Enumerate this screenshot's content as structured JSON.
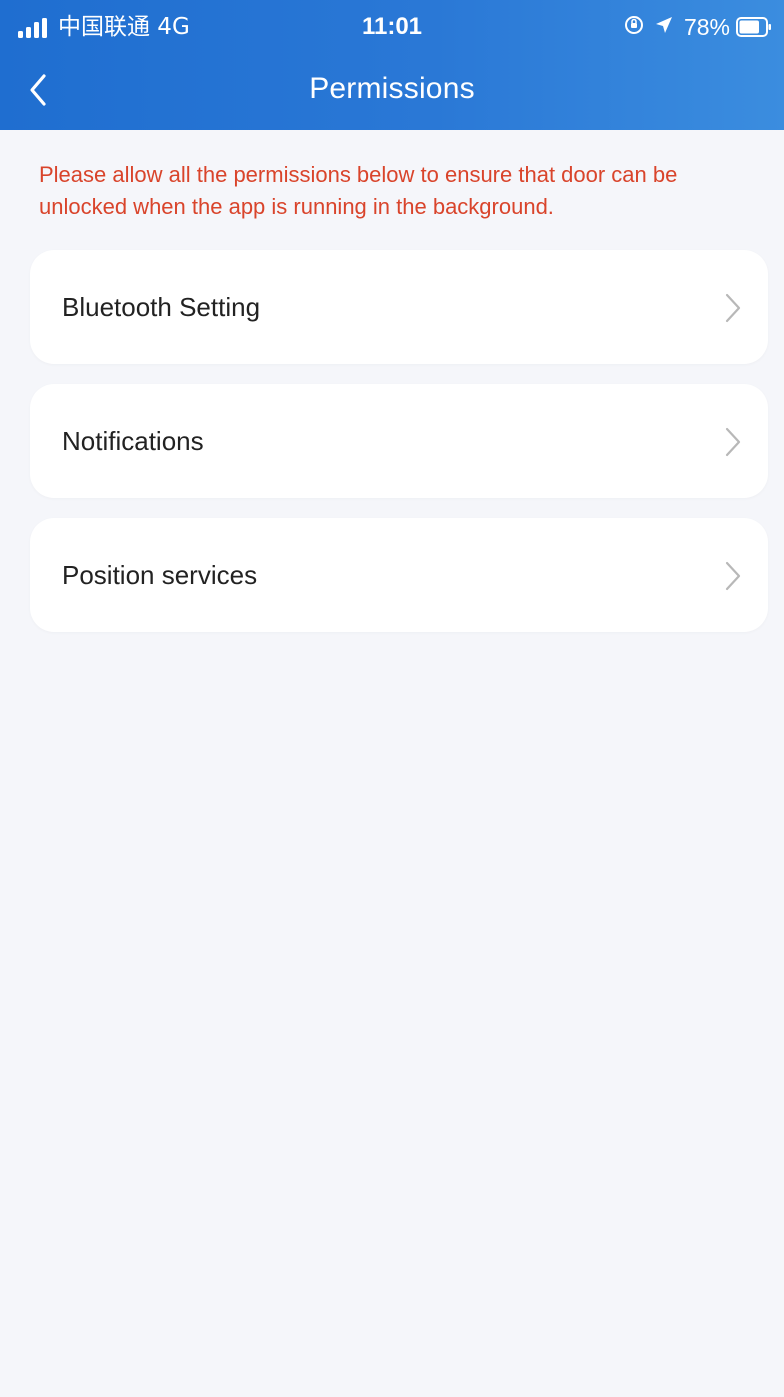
{
  "status_bar": {
    "carrier": "中国联通  4G",
    "time": "11:01",
    "battery_percent": "78%",
    "battery_level": 0.78,
    "icons": [
      "signal-icon",
      "rotation-lock-icon",
      "location-arrow-icon",
      "battery-icon"
    ]
  },
  "nav": {
    "title": "Permissions",
    "back_icon": "chevron-left-icon"
  },
  "notice": "Please allow all the permissions below to ensure that  door can be unlocked when the app is running in the background.",
  "permissions": [
    {
      "label": "Bluetooth Setting"
    },
    {
      "label": "Notifications"
    },
    {
      "label": "Position services"
    }
  ],
  "colors": {
    "header_gradient_start": "#1f6ed0",
    "header_gradient_end": "#3b8ddf",
    "notice_text": "#d9442b",
    "background": "#f5f6fa",
    "card": "#ffffff",
    "chevron": "#b8b8b8"
  }
}
